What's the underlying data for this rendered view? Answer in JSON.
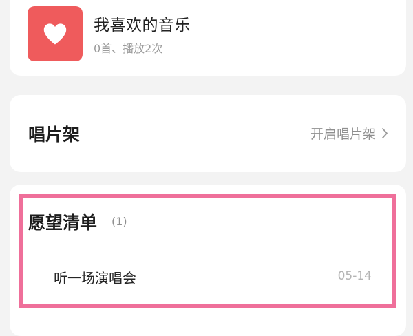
{
  "liked_music": {
    "title": "我喜欢的音乐",
    "subtitle": "0首、播放2次",
    "icon": "heart-icon",
    "cover_color": "#ef5b5c"
  },
  "record_shelf": {
    "title": "唱片架",
    "link_label": "开启唱片架",
    "link_icon": "chevron-right-icon"
  },
  "wishlist": {
    "title": "愿望清单",
    "count": "(1)",
    "items": [
      {
        "name": "听一场演唱会",
        "date": "05-14"
      }
    ]
  },
  "colors": {
    "background": "#f3f3f3",
    "card": "#ffffff",
    "highlight_border": "#ef6f9a"
  }
}
